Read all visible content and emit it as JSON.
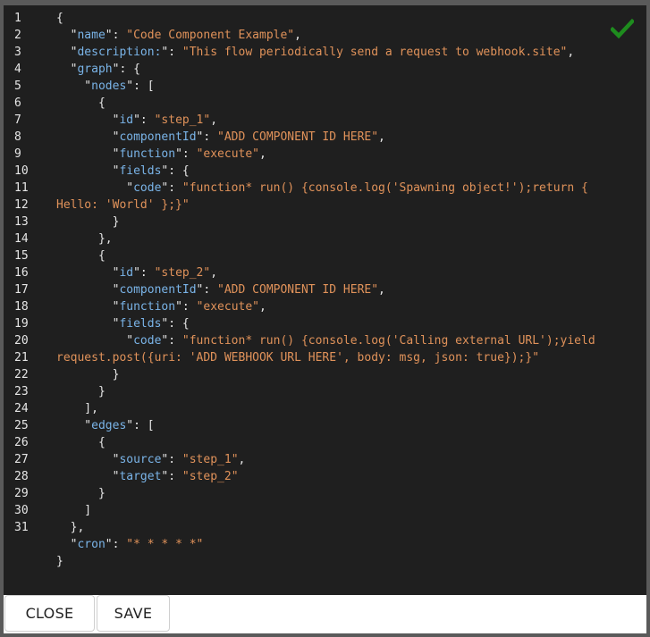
{
  "editor": {
    "line_numbers": [
      "1",
      "2",
      "3",
      "4",
      "5",
      "6",
      "7",
      "8",
      "9",
      "10",
      "11",
      "12",
      "13",
      "14",
      "15",
      "16",
      "17",
      "18",
      "19",
      "20",
      "21",
      "22",
      "23",
      "24",
      "25",
      "26",
      "27",
      "28",
      "29",
      "30",
      "31"
    ],
    "lines": [
      [
        {
          "t": "p",
          "v": "{"
        }
      ],
      [
        {
          "t": "p",
          "v": "  \""
        },
        {
          "t": "k",
          "v": "name"
        },
        {
          "t": "p",
          "v": "\": "
        },
        {
          "t": "s",
          "v": "\"Code Component Example\""
        },
        {
          "t": "p",
          "v": ","
        }
      ],
      [
        {
          "t": "p",
          "v": "  \""
        },
        {
          "t": "k",
          "v": "description:"
        },
        {
          "t": "p",
          "v": "\": "
        },
        {
          "t": "s",
          "v": "\"This flow periodically send a request to webhook.site\""
        },
        {
          "t": "p",
          "v": ","
        }
      ],
      [
        {
          "t": "p",
          "v": "  \""
        },
        {
          "t": "k",
          "v": "graph"
        },
        {
          "t": "p",
          "v": "\": {"
        }
      ],
      [
        {
          "t": "p",
          "v": "    \""
        },
        {
          "t": "k",
          "v": "nodes"
        },
        {
          "t": "p",
          "v": "\": ["
        }
      ],
      [
        {
          "t": "p",
          "v": "      {"
        }
      ],
      [
        {
          "t": "p",
          "v": "        \""
        },
        {
          "t": "k",
          "v": "id"
        },
        {
          "t": "p",
          "v": "\": "
        },
        {
          "t": "s",
          "v": "\"step_1\""
        },
        {
          "t": "p",
          "v": ","
        }
      ],
      [
        {
          "t": "p",
          "v": "        \""
        },
        {
          "t": "k",
          "v": "componentId"
        },
        {
          "t": "p",
          "v": "\": "
        },
        {
          "t": "s",
          "v": "\"ADD COMPONENT ID HERE\""
        },
        {
          "t": "p",
          "v": ","
        }
      ],
      [
        {
          "t": "p",
          "v": "        \""
        },
        {
          "t": "k",
          "v": "function"
        },
        {
          "t": "p",
          "v": "\": "
        },
        {
          "t": "s",
          "v": "\"execute\""
        },
        {
          "t": "p",
          "v": ","
        }
      ],
      [
        {
          "t": "p",
          "v": "        \""
        },
        {
          "t": "k",
          "v": "fields"
        },
        {
          "t": "p",
          "v": "\": {"
        }
      ],
      [
        {
          "t": "p",
          "v": "          \""
        },
        {
          "t": "k",
          "v": "code"
        },
        {
          "t": "p",
          "v": "\": "
        },
        {
          "t": "s",
          "v": "\"function* run() {console.log('Spawning object!');return {"
        }
      ],
      [
        {
          "t": "s",
          "v": "Hello: 'World' };}\""
        }
      ],
      [
        {
          "t": "p",
          "v": "        }"
        }
      ],
      [
        {
          "t": "p",
          "v": "      },"
        }
      ],
      [
        {
          "t": "p",
          "v": "      {"
        }
      ],
      [
        {
          "t": "p",
          "v": "        \""
        },
        {
          "t": "k",
          "v": "id"
        },
        {
          "t": "p",
          "v": "\": "
        },
        {
          "t": "s",
          "v": "\"step_2\""
        },
        {
          "t": "p",
          "v": ","
        }
      ],
      [
        {
          "t": "p",
          "v": "        \""
        },
        {
          "t": "k",
          "v": "componentId"
        },
        {
          "t": "p",
          "v": "\": "
        },
        {
          "t": "s",
          "v": "\"ADD COMPONENT ID HERE\""
        },
        {
          "t": "p",
          "v": ","
        }
      ],
      [
        {
          "t": "p",
          "v": "        \""
        },
        {
          "t": "k",
          "v": "function"
        },
        {
          "t": "p",
          "v": "\": "
        },
        {
          "t": "s",
          "v": "\"execute\""
        },
        {
          "t": "p",
          "v": ","
        }
      ],
      [
        {
          "t": "p",
          "v": "        \""
        },
        {
          "t": "k",
          "v": "fields"
        },
        {
          "t": "p",
          "v": "\": {"
        }
      ],
      [
        {
          "t": "p",
          "v": "          \""
        },
        {
          "t": "k",
          "v": "code"
        },
        {
          "t": "p",
          "v": "\": "
        },
        {
          "t": "s",
          "v": "\"function* run() {console.log('Calling external URL');yield"
        }
      ],
      [
        {
          "t": "s",
          "v": "request.post({uri: 'ADD WEBHOOK URL HERE', body: msg, json: true});}\""
        }
      ],
      [
        {
          "t": "p",
          "v": "        }"
        }
      ],
      [
        {
          "t": "p",
          "v": "      }"
        }
      ],
      [
        {
          "t": "p",
          "v": "    ],"
        }
      ],
      [
        {
          "t": "p",
          "v": "    \""
        },
        {
          "t": "k",
          "v": "edges"
        },
        {
          "t": "p",
          "v": "\": ["
        }
      ],
      [
        {
          "t": "p",
          "v": "      {"
        }
      ],
      [
        {
          "t": "p",
          "v": "        \""
        },
        {
          "t": "k",
          "v": "source"
        },
        {
          "t": "p",
          "v": "\": "
        },
        {
          "t": "s",
          "v": "\"step_1\""
        },
        {
          "t": "p",
          "v": ","
        }
      ],
      [
        {
          "t": "p",
          "v": "        \""
        },
        {
          "t": "k",
          "v": "target"
        },
        {
          "t": "p",
          "v": "\": "
        },
        {
          "t": "s",
          "v": "\"step_2\""
        }
      ],
      [
        {
          "t": "p",
          "v": "      }"
        }
      ],
      [
        {
          "t": "p",
          "v": "    ]"
        }
      ],
      [
        {
          "t": "p",
          "v": "  },"
        }
      ],
      [
        {
          "t": "p",
          "v": "  \""
        },
        {
          "t": "k",
          "v": "cron"
        },
        {
          "t": "p",
          "v": "\": "
        },
        {
          "t": "s",
          "v": "\"* * * * *\""
        }
      ],
      [
        {
          "t": "p",
          "v": "}"
        }
      ]
    ],
    "status_icon": "checkmark-icon",
    "status_color": "#1e8c1e"
  },
  "footer": {
    "close_label": "CLOSE",
    "save_label": "SAVE"
  }
}
